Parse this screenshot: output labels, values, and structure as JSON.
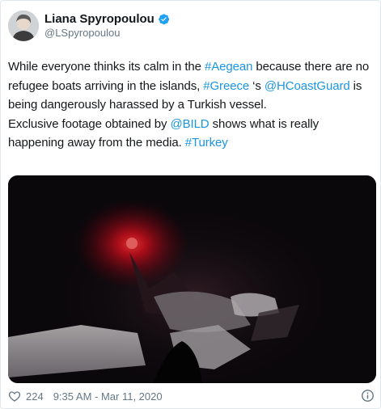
{
  "author": {
    "display_name": "Liana Spyropoulou",
    "handle": "@LSpyropoulou",
    "verified": true,
    "avatar_icon": "user-avatar"
  },
  "tweet": {
    "line1_pre": "While everyone thinks its calm in the ",
    "tag_aegean": "#Aegean",
    "line1_post": " because there are no refugee boats arriving in the islands, ",
    "tag_greece": "#Greece",
    "after_greece": " ‘s ",
    "mention_coast": "@HCoastGuard",
    "after_coast": " is being dangerously harassed by a Turkish vessel.",
    "line2_pre": "Exclusive footage obtained by ",
    "mention_bild": "@BILD",
    "line2_mid": " shows what is really happening away from the media. ",
    "tag_turkey": "#Turkey"
  },
  "footer": {
    "likes": "224",
    "timestamp": "9:35 AM - Mar 11, 2020"
  },
  "colors": {
    "link": "#1b95e0",
    "text": "#14171a",
    "muted": "#657786",
    "verified": "#1da1f2",
    "signal_light": "#ff2a2a"
  },
  "icons": [
    "verified-badge-icon",
    "heart-icon",
    "info-icon"
  ]
}
